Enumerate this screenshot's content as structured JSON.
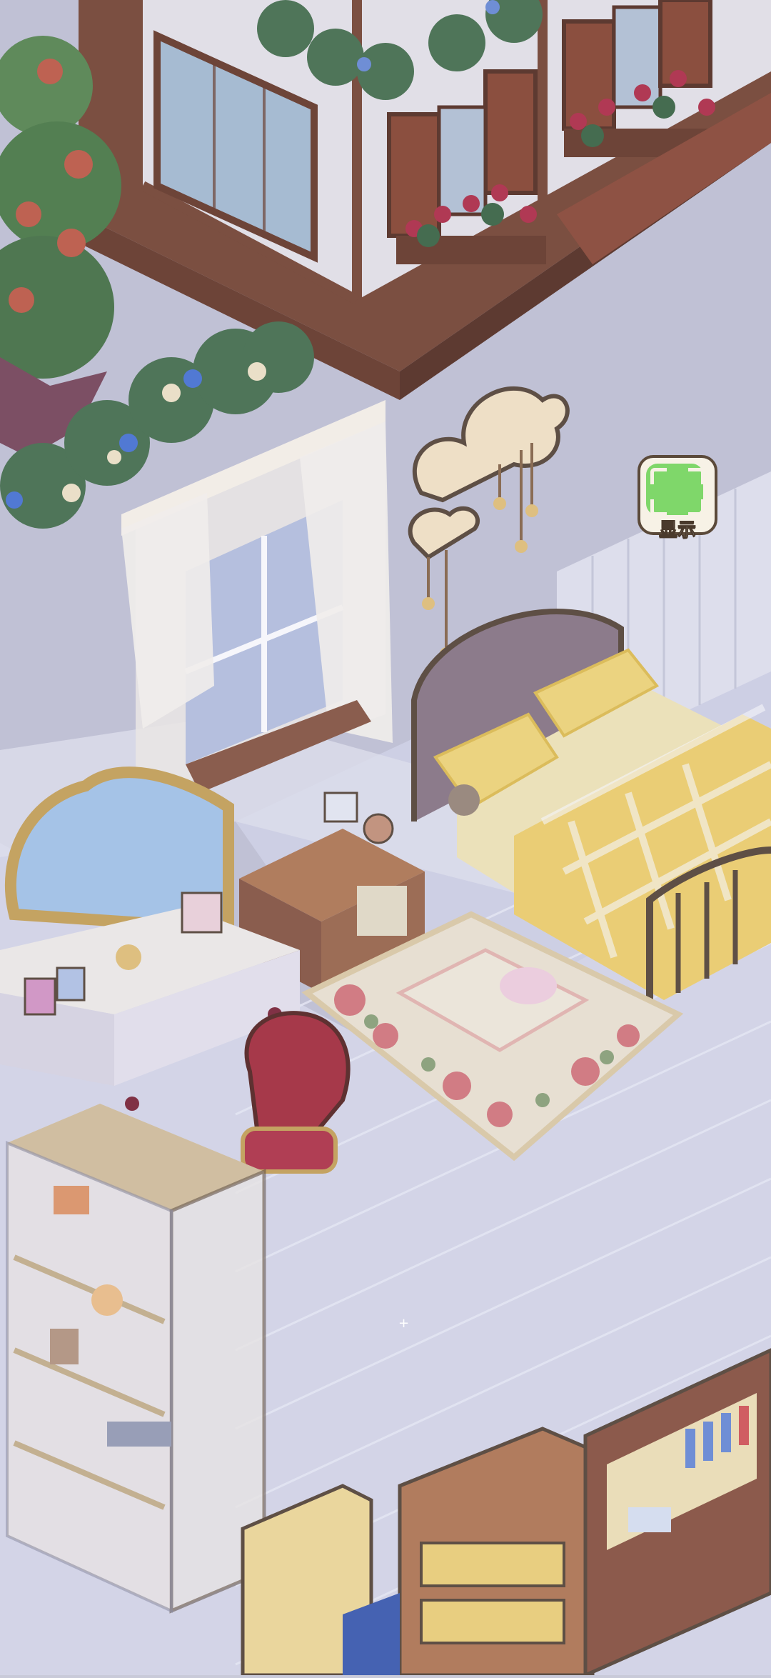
{
  "scene": {
    "description_icon_names": [
      "house-facade",
      "flower-vines",
      "cloud-lamp",
      "window-with-curtains",
      "bed",
      "nightstand",
      "rug",
      "vanity-desk",
      "chair",
      "glass-cabinet",
      "dresser",
      "bookshelf"
    ]
  },
  "show_button": {
    "label": "显示",
    "icon": "frame-corners-icon",
    "accent": "#7fd76a"
  },
  "colors": {
    "wall": "#c9cad9",
    "floor": "#d7d9e8",
    "wood": "#8a5a44",
    "bedding_yellow": "#f3dc7a"
  }
}
